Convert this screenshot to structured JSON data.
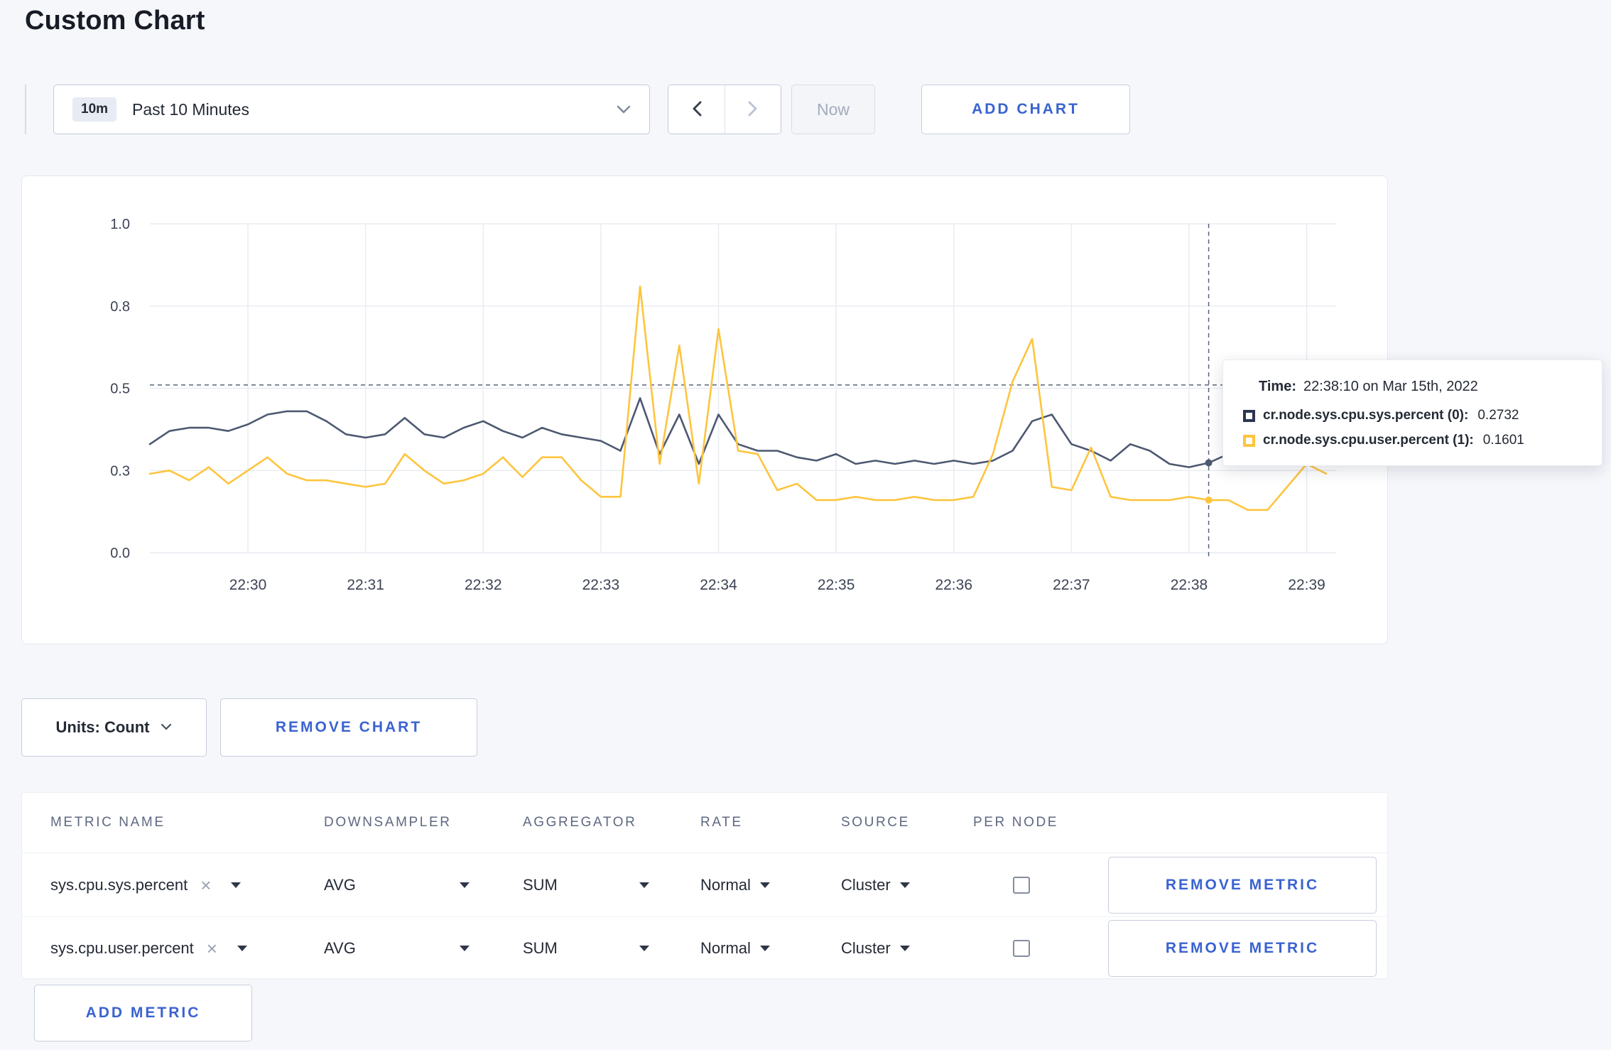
{
  "page": {
    "title": "Custom Chart"
  },
  "colors": {
    "accent": "#3a63d1",
    "series_sys": "#4d5871",
    "series_user": "#fdc53e"
  },
  "toolbar": {
    "time_range": {
      "badge": "10m",
      "label": "Past 10 Minutes"
    },
    "now_label": "Now",
    "add_chart_label": "ADD CHART"
  },
  "chart_controls": {
    "units_label": "Units: Count",
    "remove_chart_label": "REMOVE CHART"
  },
  "tooltip": {
    "time_label": "Time:",
    "time_value": "22:38:10 on Mar 15th, 2022",
    "series": [
      {
        "label": "cr.node.sys.cpu.sys.percent (0):",
        "value": "0.2732",
        "color": "#2a3650"
      },
      {
        "label": "cr.node.sys.cpu.user.percent (1):",
        "value": "0.1601",
        "color": "#fdc53e"
      }
    ]
  },
  "metrics_table": {
    "headers": [
      "METRIC NAME",
      "DOWNSAMPLER",
      "AGGREGATOR",
      "RATE",
      "SOURCE",
      "PER NODE"
    ],
    "rows": [
      {
        "metric": "sys.cpu.sys.percent",
        "downsampler": "AVG",
        "aggregator": "SUM",
        "rate": "Normal",
        "source": "Cluster",
        "per_node_checked": false,
        "remove_label": "REMOVE METRIC"
      },
      {
        "metric": "sys.cpu.user.percent",
        "downsampler": "AVG",
        "aggregator": "SUM",
        "rate": "Normal",
        "source": "Cluster",
        "per_node_checked": false,
        "remove_label": "REMOVE METRIC"
      }
    ],
    "add_metric_label": "ADD METRIC"
  },
  "chart_data": {
    "type": "line",
    "ylim": [
      0,
      1.0
    ],
    "y_ticks": [
      {
        "value": 0,
        "label": "0.0"
      },
      {
        "value": 0.25,
        "label": "0.3"
      },
      {
        "value": 0.5,
        "label": "0.5"
      },
      {
        "value": 0.75,
        "label": "0.8"
      },
      {
        "value": 1.0,
        "label": "1.0"
      }
    ],
    "x_labels": [
      "22:30",
      "22:31",
      "22:32",
      "22:33",
      "22:34",
      "22:35",
      "22:36",
      "22:37",
      "22:38",
      "22:39"
    ],
    "x_total_seconds": 605,
    "x_first_tick_offset_seconds": 50,
    "tick_interval_seconds": 60,
    "point_interval_seconds": 10,
    "grid": true,
    "legend": "tooltip-only",
    "crosshair": {
      "point_index": 54,
      "time": "22:38:10",
      "h_value": 0.51
    },
    "series": [
      {
        "name": "cr.node.sys.cpu.sys.percent",
        "color": "#4d5871",
        "values": [
          0.33,
          0.37,
          0.38,
          0.38,
          0.37,
          0.39,
          0.42,
          0.43,
          0.43,
          0.4,
          0.36,
          0.35,
          0.36,
          0.41,
          0.36,
          0.35,
          0.38,
          0.4,
          0.37,
          0.35,
          0.38,
          0.36,
          0.35,
          0.34,
          0.31,
          0.47,
          0.3,
          0.42,
          0.27,
          0.42,
          0.33,
          0.31,
          0.31,
          0.29,
          0.28,
          0.3,
          0.27,
          0.28,
          0.27,
          0.28,
          0.27,
          0.28,
          0.27,
          0.28,
          0.31,
          0.4,
          0.42,
          0.33,
          0.31,
          0.28,
          0.33,
          0.31,
          0.27,
          0.26,
          0.2732,
          0.3,
          0.31,
          0.3,
          0.3,
          0.31,
          0.3
        ]
      },
      {
        "name": "cr.node.sys.cpu.user.percent",
        "color": "#fdc53e",
        "values": [
          0.24,
          0.25,
          0.22,
          0.26,
          0.21,
          0.25,
          0.29,
          0.24,
          0.22,
          0.22,
          0.21,
          0.2,
          0.21,
          0.3,
          0.25,
          0.21,
          0.22,
          0.24,
          0.29,
          0.23,
          0.29,
          0.29,
          0.22,
          0.17,
          0.17,
          0.81,
          0.27,
          0.63,
          0.21,
          0.68,
          0.31,
          0.3,
          0.19,
          0.21,
          0.16,
          0.16,
          0.17,
          0.16,
          0.16,
          0.17,
          0.16,
          0.16,
          0.17,
          0.3,
          0.52,
          0.65,
          0.2,
          0.19,
          0.32,
          0.17,
          0.16,
          0.16,
          0.16,
          0.17,
          0.1601,
          0.16,
          0.13,
          0.13,
          0.2,
          0.27,
          0.24
        ]
      }
    ]
  }
}
